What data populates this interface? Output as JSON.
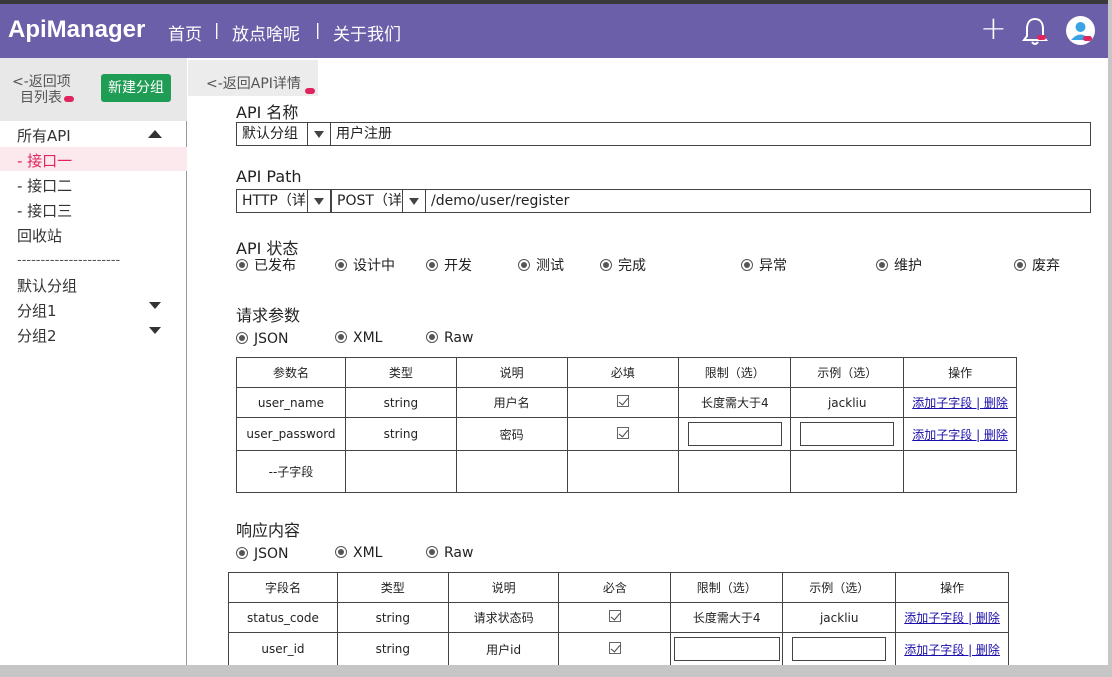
{
  "header": {
    "logo": "ApiManager",
    "nav": [
      "首页",
      "放点啥呢",
      "关于我们"
    ],
    "nav_sep": "|",
    "plus_label": "+"
  },
  "sidebar": {
    "back_label_1": "<-返回项",
    "back_label_2": "目列表",
    "new_group_label": "新建分组",
    "all_api_label": "所有API",
    "items": [
      "- 接口一",
      "- 接口二",
      "- 接口三"
    ],
    "recycle_label": "回收站",
    "divider": "----------------------",
    "groups": [
      "默认分组",
      "分组1",
      "分组2"
    ],
    "active_color": "#e0245e"
  },
  "content": {
    "back_label": "<-返回API详情",
    "api_name": {
      "label": "API 名称",
      "group_value": "默认分组",
      "name_value": "用户注册"
    },
    "api_path": {
      "label": "API Path",
      "protocol_value": "HTTP（详",
      "method_value": "POST（详",
      "path_value": "/demo/user/register"
    },
    "api_status": {
      "label": "API 状态",
      "options": [
        "已发布",
        "设计中",
        "开发",
        "测试",
        "完成",
        "异常",
        "维护",
        "废弃"
      ]
    },
    "request": {
      "label": "请求参数",
      "formats": [
        "JSON",
        "XML",
        "Raw"
      ],
      "columns": [
        "参数名",
        "类型",
        "说明",
        "必填",
        "限制（选）",
        "示例（选）",
        "操作"
      ],
      "rows": [
        {
          "name": "user_name",
          "type": "string",
          "desc": "用户名",
          "limit": "长度需大于4",
          "example": "jackliu",
          "action": "添加子字段 | 删除"
        },
        {
          "name": "user_password",
          "type": "string",
          "desc": "密码",
          "limit": "",
          "example": "",
          "action": "添加子字段 | 删除"
        },
        {
          "name": "--子字段",
          "type": "",
          "desc": "",
          "limit": "",
          "example": "",
          "action": ""
        }
      ]
    },
    "response": {
      "label": "响应内容",
      "formats": [
        "JSON",
        "XML",
        "Raw"
      ],
      "columns": [
        "字段名",
        "类型",
        "说明",
        "必含",
        "限制（选）",
        "示例（选）",
        "操作"
      ],
      "rows": [
        {
          "name": "status_code",
          "type": "string",
          "desc": "请求状态码",
          "limit": "长度需大于4",
          "example": "jackliu",
          "action": "添加子字段 | 删除"
        },
        {
          "name": "user_id",
          "type": "string",
          "desc": "用户id",
          "limit": "",
          "example": "",
          "action": "添加子字段 | 删除"
        }
      ]
    }
  },
  "colors": {
    "header_bg": "#6a5fa8",
    "button_green": "#1f9d55"
  }
}
